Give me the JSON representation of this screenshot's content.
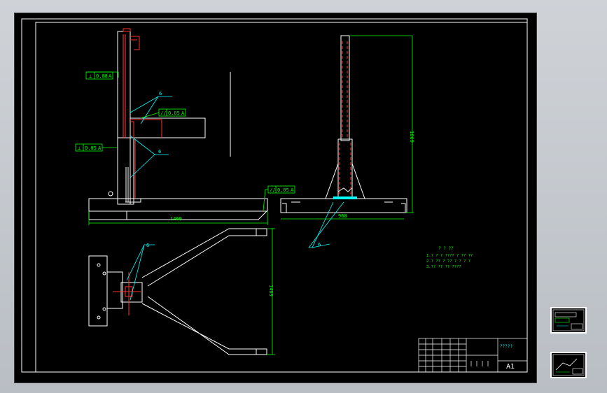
{
  "drawing": {
    "dimensions": {
      "base_length": "1460",
      "front_height": "1669",
      "front_base_width": "960",
      "plan_length": "1409"
    },
    "tolerances": {
      "perp_top": "0.08",
      "parallel": "0.05",
      "perp_bottom": "0.05",
      "parallel_base": "0.05",
      "datum": "A"
    },
    "welds": {
      "weld_1": "6",
      "weld_2": "6",
      "weld_3": "6",
      "weld_4": "6",
      "weld_5": "6"
    },
    "notes": {
      "title": "? ? ??",
      "line_1": "1.? ? ? ????   ? ?? ??",
      "line_2": "2.? ?? ? ?? ? ? ? ?",
      "line_3": "3.?? ?? ?? ????"
    },
    "title_block": {
      "drawing_name": "?????",
      "sheet_size": "A1"
    }
  },
  "colors": {
    "outline": "#ffffff",
    "dimension": "#00ff00",
    "leader": "#00ffff",
    "hidden": "#ff0000",
    "background": "#000000"
  }
}
